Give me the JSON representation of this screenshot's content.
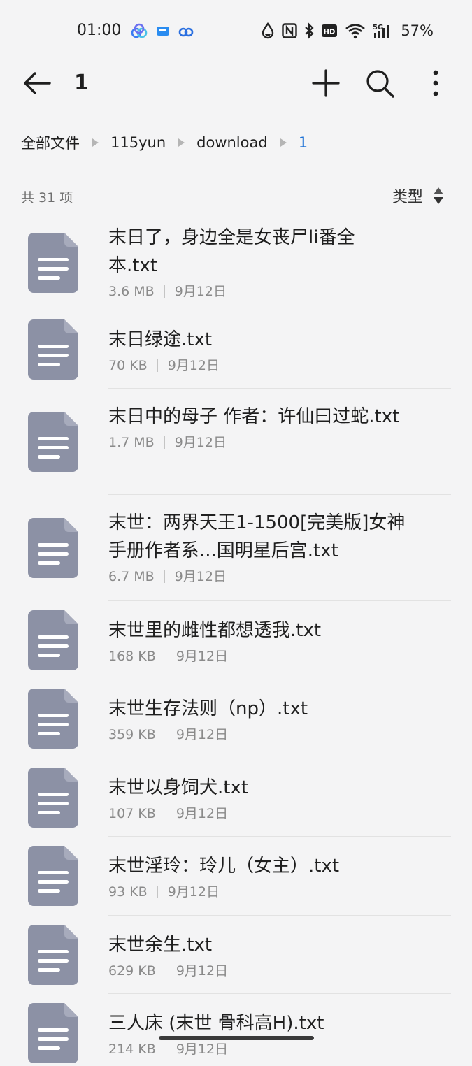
{
  "status_bar": {
    "time": "01:00",
    "battery": "57%",
    "notification_icons": [
      "baidu-netdisk-icon",
      "message-icon",
      "cloud-link-icon"
    ],
    "system_icons": [
      "dnd-drop-icon",
      "nfc-icon",
      "bluetooth-icon",
      "hd-icon",
      "wifi-icon",
      "5g-signal-icon"
    ]
  },
  "app_bar": {
    "title": "1",
    "icons": [
      "back-arrow-icon",
      "plus-icon",
      "search-icon",
      "more-vertical-icon"
    ]
  },
  "breadcrumb": [
    "全部文件",
    "115yun",
    "download",
    "1"
  ],
  "list_header": {
    "count": "共 31 项",
    "sort_label": "类型"
  },
  "colors": {
    "accent": "#1e72d6",
    "file_icon": "#8c91a5",
    "background": "#f4f4f5"
  },
  "files": [
    {
      "name": "末日了，身边全是女丧尸li番全本.txt",
      "size": "3.6 MB",
      "date": "9月12日"
    },
    {
      "name": "末日绿途.txt",
      "size": "70 KB",
      "date": "9月12日"
    },
    {
      "name": "末日中的母子 作者：许仙曰过蛇.txt",
      "size": "1.7 MB",
      "date": "9月12日"
    },
    {
      "name": "末世：两界天王1-1500[完美版]女神手册作者系...国明星后宫.txt",
      "size": "6.7 MB",
      "date": "9月12日"
    },
    {
      "name": "末世里的雌性都想透我.txt",
      "size": "168 KB",
      "date": "9月12日"
    },
    {
      "name": "末世生存法则（np）.txt",
      "size": "359 KB",
      "date": "9月12日"
    },
    {
      "name": "末世以身饲犬.txt",
      "size": "107 KB",
      "date": "9月12日"
    },
    {
      "name": "末世淫玲：玲儿（女主）.txt",
      "size": "93 KB",
      "date": "9月12日"
    },
    {
      "name": "末世余生.txt",
      "size": "629 KB",
      "date": "9月12日"
    },
    {
      "name": "三人床 (末世 骨科高H).txt",
      "size": "214 KB",
      "date": "9月12日"
    }
  ]
}
